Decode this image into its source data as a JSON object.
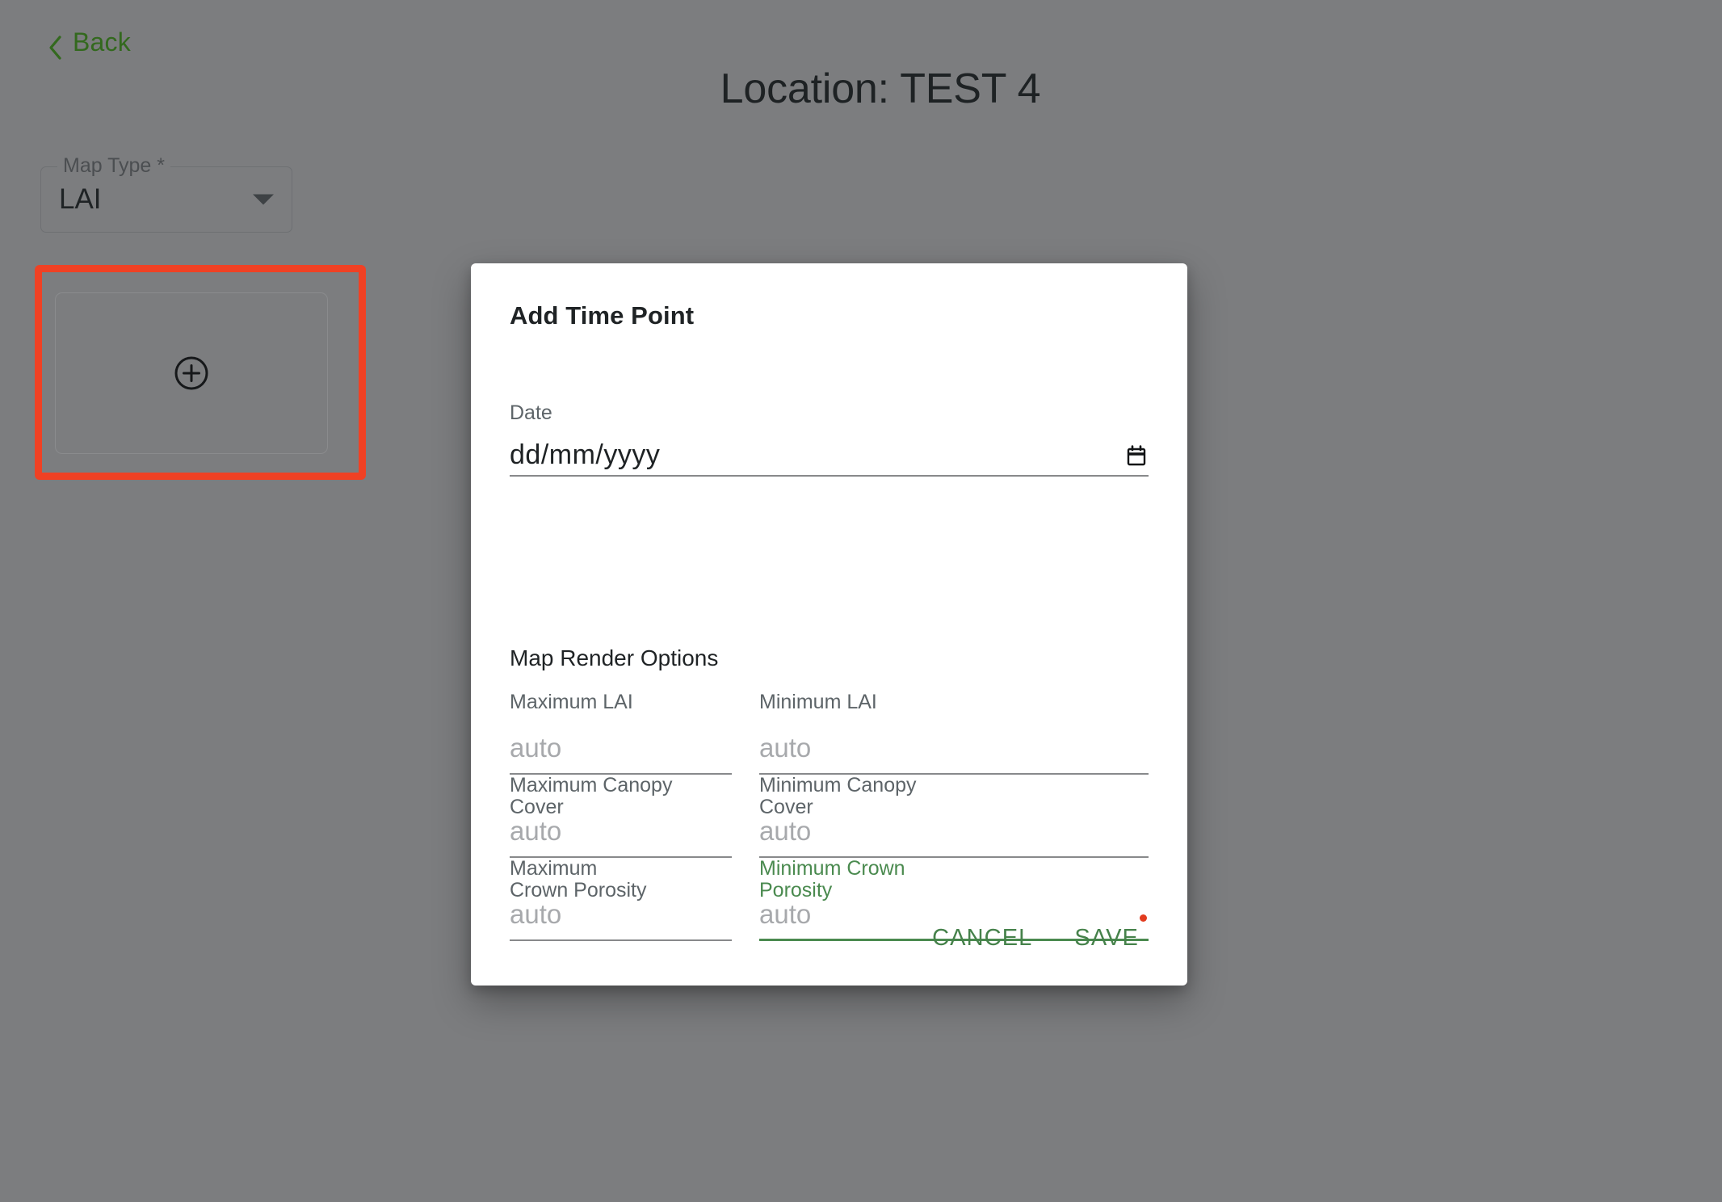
{
  "header": {
    "back_label": "Back",
    "back_icon": "chevron-left-icon",
    "page_title": "Location: TEST 4"
  },
  "map_type": {
    "label": "Map Type *",
    "value": "LAI",
    "dropdown_icon": "chevron-down-icon"
  },
  "time_points": {
    "add_card_icon": "plus-circle-icon",
    "annotation_color": "#f04124"
  },
  "dialog": {
    "title": "Add Time Point",
    "date": {
      "label": "Date",
      "placeholder": "dd/mm/yyyy",
      "value": "dd/mm/yyyy",
      "calendar_icon": "calendar-icon"
    },
    "render_options": {
      "heading": "Map Render Options",
      "fields": [
        {
          "label": "Maximum LAI",
          "placeholder": "auto",
          "value": "",
          "focused": false
        },
        {
          "label": "Minimum LAI",
          "placeholder": "auto",
          "value": "",
          "focused": false
        },
        {
          "label": "Maximum Canopy Cover",
          "placeholder": "auto",
          "value": "",
          "focused": false
        },
        {
          "label": "Minimum Canopy Cover",
          "placeholder": "auto",
          "value": "",
          "focused": false
        },
        {
          "label": "Maximum Crown Porosity",
          "placeholder": "auto",
          "value": "",
          "focused": false
        },
        {
          "label": "Minimum Crown Porosity",
          "placeholder": "auto",
          "value": "",
          "focused": true
        }
      ]
    },
    "actions": {
      "cancel_label": "CANCEL",
      "save_label": "SAVE"
    },
    "accent_color": "#46824b"
  }
}
